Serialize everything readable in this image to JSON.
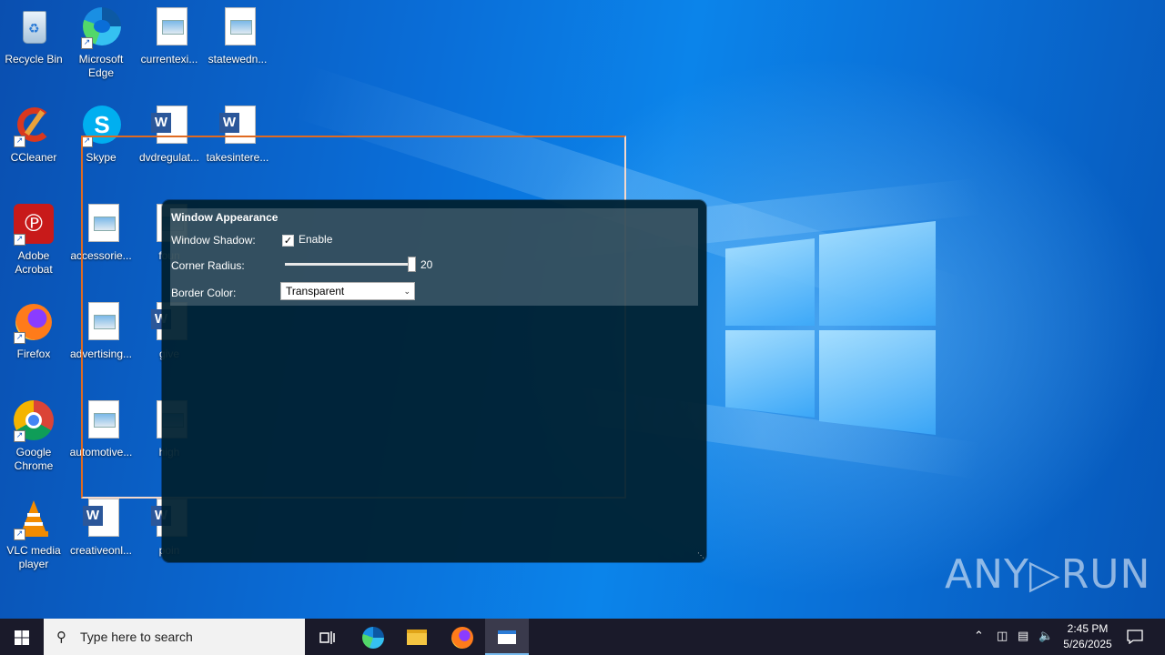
{
  "desktop_icons": [
    {
      "label": "Recycle Bin",
      "icon": "recycle-bin-icon"
    },
    {
      "label": "Microsoft Edge",
      "icon": "edge-icon"
    },
    {
      "label": "currentexi...",
      "icon": "image-file-icon"
    },
    {
      "label": "statewedn...",
      "icon": "image-file-icon"
    },
    {
      "label": "CCleaner",
      "icon": "ccleaner-icon"
    },
    {
      "label": "Skype",
      "icon": "skype-icon"
    },
    {
      "label": "dvdregulat...",
      "icon": "word-doc-icon"
    },
    {
      "label": "takesintere...",
      "icon": "word-doc-icon"
    },
    {
      "label": "Adobe Acrobat",
      "icon": "acrobat-icon"
    },
    {
      "label": "accessorie...",
      "icon": "image-file-icon"
    },
    {
      "label": "foun",
      "icon": "image-file-icon"
    },
    {
      "label": "Firefox",
      "icon": "firefox-icon"
    },
    {
      "label": "advertising...",
      "icon": "image-file-icon"
    },
    {
      "label": "give",
      "icon": "word-doc-icon"
    },
    {
      "label": "Google Chrome",
      "icon": "chrome-icon"
    },
    {
      "label": "automotive...",
      "icon": "image-file-icon"
    },
    {
      "label": "high",
      "icon": "image-file-icon"
    },
    {
      "label": "VLC media player",
      "icon": "vlc-icon"
    },
    {
      "label": "creativeonl...",
      "icon": "word-doc-icon"
    },
    {
      "label": "poin",
      "icon": "word-doc-icon"
    }
  ],
  "window": {
    "panel_title": "Window Appearance",
    "shadow_label": "Window Shadow:",
    "shadow_checkbox_label": "Enable",
    "shadow_enabled": true,
    "radius_label": "Corner Radius:",
    "radius_value": "20",
    "border_label": "Border Color:",
    "border_value": "Transparent"
  },
  "watermark": "ANY▷RUN",
  "taskbar": {
    "search_placeholder": "Type here to search",
    "time": "2:45 PM",
    "date": "5/26/2025"
  },
  "colors": {
    "selection_border": "#e06a20",
    "window_bg": "#002030",
    "taskbar_bg": "#1a1a2a"
  }
}
